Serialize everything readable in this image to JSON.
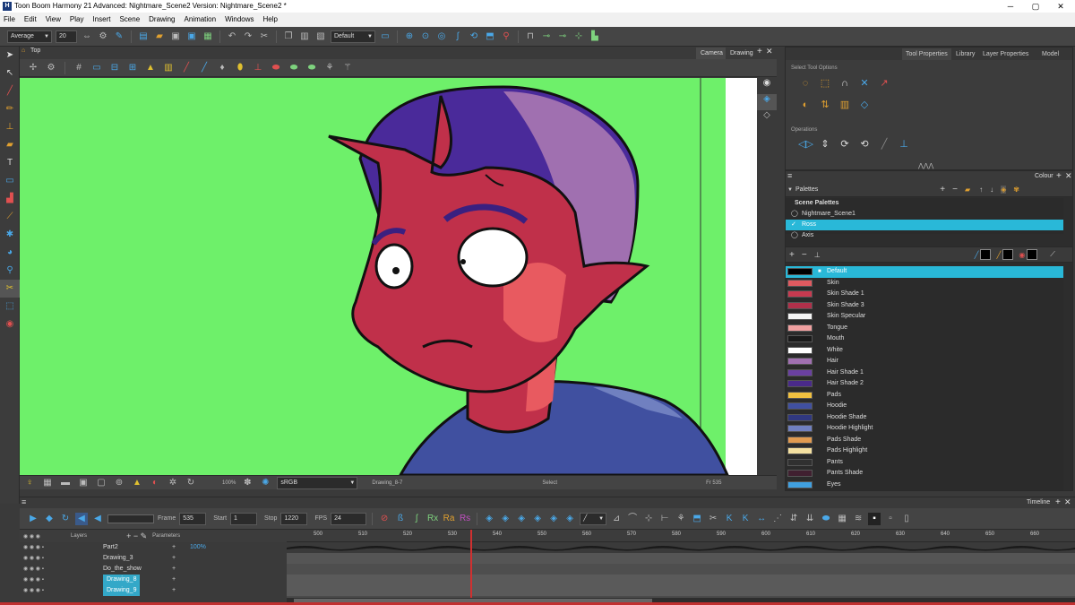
{
  "window": {
    "title": "Toon Boom Harmony 21 Advanced: Nightmare_Scene2 Version: Nightmare_Scene2 *",
    "app_icon": "H",
    "controls": [
      "─",
      "▢",
      "✕"
    ]
  },
  "menu": [
    "File",
    "Edit",
    "View",
    "Play",
    "Insert",
    "Scene",
    "Drawing",
    "Animation",
    "Windows",
    "Help"
  ],
  "toolbar": {
    "brush_preset": "Average",
    "brush_size": "20",
    "palette_preset": "Default"
  },
  "camera_view": {
    "tabs": [
      "Camera",
      "Drawing"
    ],
    "label": "Top",
    "status": {
      "zoom": "100%",
      "colorspace": "sRGB",
      "drawing": "Drawing_8-7",
      "tool": "Select",
      "frame": "Fr 535"
    }
  },
  "tool_properties": {
    "tabs": [
      "Tool Properties",
      "Library",
      "Layer Properties",
      "Model"
    ],
    "section1": "Select Tool Options",
    "section2": "Operations"
  },
  "colour_panel": {
    "title": "Colour",
    "palettes_label": "Palettes",
    "scene_palettes_label": "Scene Palettes",
    "palettes": [
      {
        "name": "Nightmare_Scene1",
        "selected": false
      },
      {
        "name": "Ross",
        "selected": true
      },
      {
        "name": "Axis",
        "selected": false
      }
    ],
    "swatches": [
      {
        "name": "Default",
        "color": "#000000",
        "selected": true
      },
      {
        "name": "Skin",
        "color": "#e05a60",
        "selected": false
      },
      {
        "name": "Skin Shade 1",
        "color": "#c83a50",
        "selected": false
      },
      {
        "name": "Skin Shade 3",
        "color": "#b0304a",
        "selected": false
      },
      {
        "name": "Skin Specular",
        "color": "#f4f4f4",
        "selected": false
      },
      {
        "name": "Tongue",
        "color": "#f0a0a0",
        "selected": false
      },
      {
        "name": "Mouth",
        "color": "#1a1a1a",
        "selected": false
      },
      {
        "name": "White",
        "color": "#ffffff",
        "selected": false
      },
      {
        "name": "Hair",
        "color": "#a070b0",
        "selected": false
      },
      {
        "name": "Hair Shade 1",
        "color": "#6a40a0",
        "selected": false
      },
      {
        "name": "Hair Shade 2",
        "color": "#4a2a8a",
        "selected": false
      },
      {
        "name": "Pads",
        "color": "#f0c040",
        "selected": false
      },
      {
        "name": "Hoodie",
        "color": "#4050a0",
        "selected": false
      },
      {
        "name": "Hoodie Shade",
        "color": "#303880",
        "selected": false
      },
      {
        "name": "Hoodie Highlight",
        "color": "#7080c0",
        "selected": false
      },
      {
        "name": "Pads Shade",
        "color": "#e09a50",
        "selected": false
      },
      {
        "name": "Pads Highlight",
        "color": "#f4e0a0",
        "selected": false
      },
      {
        "name": "Pants",
        "color": "#303030",
        "selected": false
      },
      {
        "name": "Pants Shade",
        "color": "#402030",
        "selected": false
      },
      {
        "name": "Eyes",
        "color": "#40a0e0",
        "selected": false
      }
    ]
  },
  "timeline": {
    "title": "Timeline",
    "frame_label": "Frame",
    "frame": "535",
    "start_label": "Start",
    "start": "1",
    "stop_label": "Stop",
    "stop": "1220",
    "fps_label": "FPS",
    "fps": "24",
    "layers_label": "Layers",
    "parameters_label": "Parameters",
    "ruler": [
      "500",
      "510",
      "520",
      "530",
      "540",
      "550",
      "560",
      "570",
      "580",
      "590",
      "600",
      "610",
      "620",
      "630",
      "640",
      "650",
      "660"
    ],
    "layers": [
      {
        "name": "Part2",
        "param": "100%",
        "highlight": false
      },
      {
        "name": "Drawing_3",
        "param": "",
        "highlight": false
      },
      {
        "name": "Do_the_show",
        "param": "",
        "highlight": false
      },
      {
        "name": "Drawing_8",
        "param": "",
        "highlight": true
      },
      {
        "name": "Drawing_9",
        "param": "",
        "highlight": true
      }
    ],
    "playhead_frame": 535
  },
  "icons": {
    "select": "arrow-icon",
    "brush": "brush-icon",
    "pencil": "pencil-icon",
    "text": "text-icon",
    "zoom": "magnifier-icon"
  }
}
